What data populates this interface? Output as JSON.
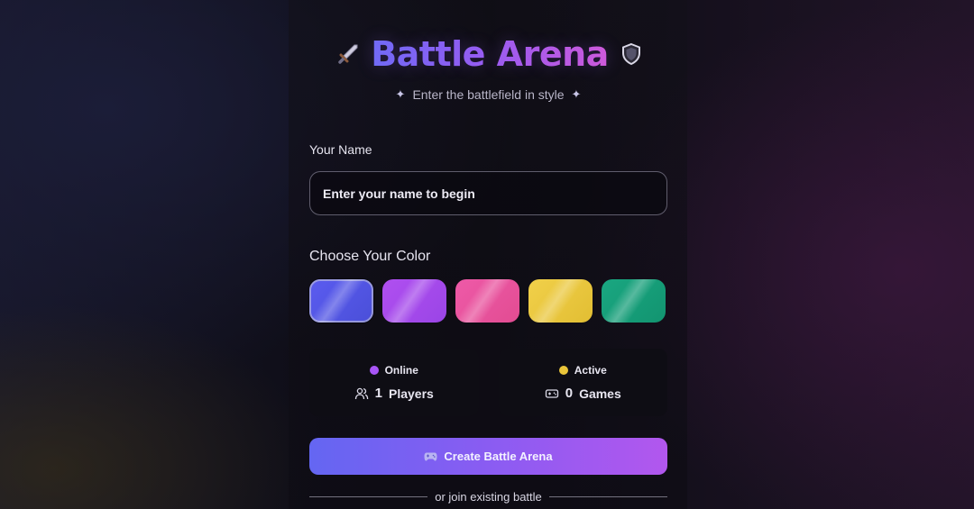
{
  "header": {
    "title": "Battle Arena",
    "subtitle": "Enter the battlefield in style",
    "left_icon": "sword-icon",
    "right_icon": "shield-icon",
    "sparkle_icon": "sparkle-icon"
  },
  "name_section": {
    "label": "Your Name",
    "placeholder": "Enter your name to begin",
    "value": ""
  },
  "color_section": {
    "label": "Choose Your Color",
    "selected_index": 0,
    "colors": [
      {
        "name": "blue",
        "from": "#5b5cf0",
        "to": "#4a4fd8"
      },
      {
        "name": "purple",
        "from": "#b04ff0",
        "to": "#9a45e6"
      },
      {
        "name": "pink",
        "from": "#ee5aa8",
        "to": "#e24c92"
      },
      {
        "name": "yellow",
        "from": "#f1d04a",
        "to": "#e2be33"
      },
      {
        "name": "green",
        "from": "#1aa781",
        "to": "#129470"
      }
    ]
  },
  "stats": {
    "online": {
      "status": "Online",
      "dot_color": "#a855f7",
      "count": "1",
      "unit": "Players",
      "icon": "users-icon"
    },
    "active": {
      "status": "Active",
      "dot_color": "#eac53a",
      "count": "0",
      "unit": "Games",
      "icon": "gamepad-icon"
    }
  },
  "actions": {
    "create_label": "Create Battle Arena",
    "create_icon": "gamepad-icon",
    "divider_text": "or join existing battle"
  }
}
